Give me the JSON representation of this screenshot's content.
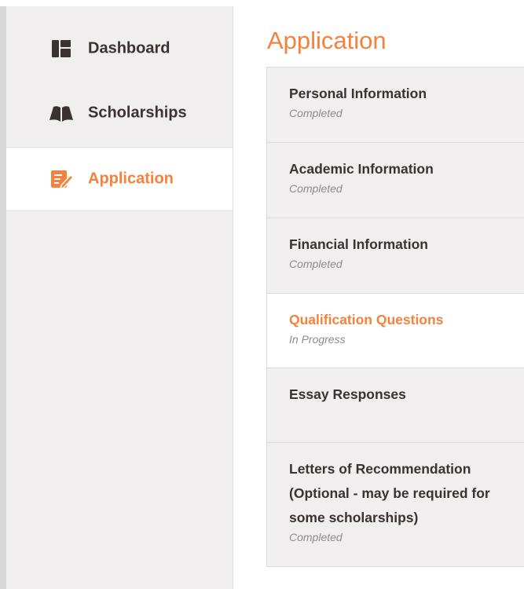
{
  "sidebar": {
    "items": [
      {
        "label": "Dashboard",
        "icon": "dashboard-icon"
      },
      {
        "label": "Scholarships",
        "icon": "book-icon"
      },
      {
        "label": "Application",
        "icon": "edit-icon",
        "active": true
      }
    ]
  },
  "main": {
    "title": "Application",
    "steps": [
      {
        "title": "Personal Information",
        "status": "Completed"
      },
      {
        "title": "Academic Information",
        "status": "Completed"
      },
      {
        "title": "Financial Information",
        "status": "Completed"
      },
      {
        "title": "Qualification Questions",
        "status": "In Progress",
        "active": true
      },
      {
        "title": "Essay Responses",
        "status": ""
      },
      {
        "title": "Letters of Recommendation (Optional - may be required for some scholarships)",
        "status": "Completed"
      }
    ]
  },
  "colors": {
    "accent": "#f4823c",
    "text": "#3a3332",
    "muted": "#8f8a8a",
    "sidebar_bg": "#f0eeee"
  }
}
